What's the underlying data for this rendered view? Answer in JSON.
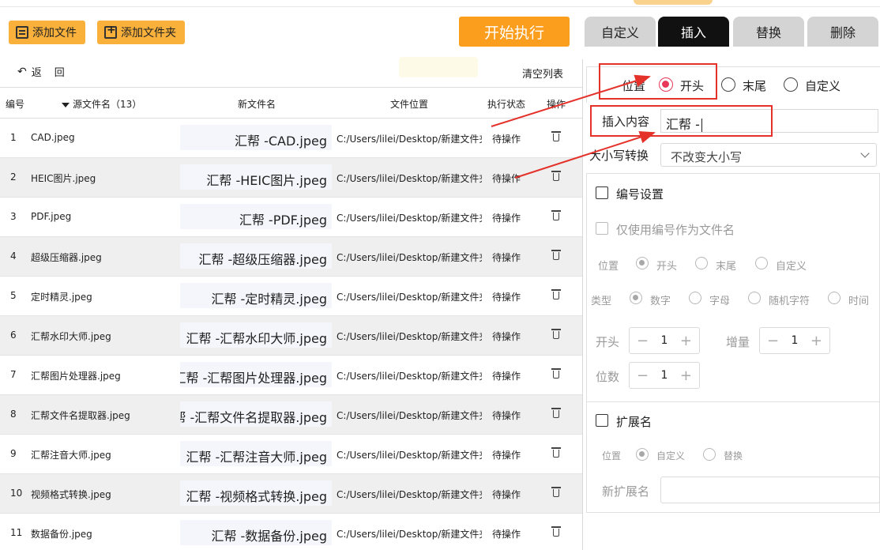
{
  "toolbar": {
    "add_file": "添加文件",
    "add_folder": "添加文件夹",
    "start": "开始执行",
    "tabs": [
      "自定义",
      "插入",
      "替换",
      "删除"
    ],
    "active_tab": "插入"
  },
  "list": {
    "back": "返",
    "back2": "回",
    "clear": "清空列表",
    "headers": {
      "num": "编号",
      "src": "源文件名（13）",
      "new": "新文件名",
      "pos": "文件位置",
      "status": "执行状态",
      "op": "操作"
    },
    "rows": [
      {
        "num": "1",
        "src": "CAD.jpeg",
        "new": "汇帮 -CAD.jpeg",
        "pos": "C:/Users/lilei/Desktop/新建文件夹",
        "status": "待操作"
      },
      {
        "num": "2",
        "src": "HEIC图片.jpeg",
        "new": "汇帮 -HEIC图片.jpeg",
        "pos": "C:/Users/lilei/Desktop/新建文件夹",
        "status": "待操作"
      },
      {
        "num": "3",
        "src": "PDF.jpeg",
        "new": "汇帮 -PDF.jpeg",
        "pos": "C:/Users/lilei/Desktop/新建文件夹",
        "status": "待操作"
      },
      {
        "num": "4",
        "src": "超级压缩器.jpeg",
        "new": "汇帮 -超级压缩器.jpeg",
        "pos": "C:/Users/lilei/Desktop/新建文件夹",
        "status": "待操作"
      },
      {
        "num": "5",
        "src": "定时精灵.jpeg",
        "new": "汇帮 -定时精灵.jpeg",
        "pos": "C:/Users/lilei/Desktop/新建文件夹",
        "status": "待操作"
      },
      {
        "num": "6",
        "src": "汇帮水印大师.jpeg",
        "new": "汇帮 -汇帮水印大师.jpeg",
        "pos": "C:/Users/lilei/Desktop/新建文件夹",
        "status": "待操作"
      },
      {
        "num": "7",
        "src": "汇帮图片处理器.jpeg",
        "new": "汇帮 -汇帮图片处理器.jpeg",
        "pos": "C:/Users/lilei/Desktop/新建文件夹",
        "status": "待操作"
      },
      {
        "num": "8",
        "src": "汇帮文件名提取器.jpeg",
        "new": "汇帮 -汇帮文件名提取器.jpeg",
        "pos": "C:/Users/lilei/Desktop/新建文件夹",
        "status": "待操作"
      },
      {
        "num": "9",
        "src": "汇帮注音大师.jpeg",
        "new": "汇帮 -汇帮注音大师.jpeg",
        "pos": "C:/Users/lilei/Desktop/新建文件夹",
        "status": "待操作"
      },
      {
        "num": "10",
        "src": "视频格式转换.jpeg",
        "new": "汇帮 -视频格式转换.jpeg",
        "pos": "C:/Users/lilei/Desktop/新建文件夹",
        "status": "待操作"
      },
      {
        "num": "11",
        "src": "数据备份.jpeg",
        "new": "汇帮 -数据备份.jpeg",
        "pos": "C:/Users/lilei/Desktop/新建文件夹",
        "status": "待操作"
      }
    ]
  },
  "panel": {
    "position_label": "位置",
    "position_options": [
      "开头",
      "末尾",
      "自定义"
    ],
    "position_selected": "开头",
    "insert_label": "插入内容",
    "insert_value": "汇帮 -",
    "case_label": "大小写转换",
    "case_value": "不改变大小写",
    "numbering": {
      "title": "编号设置",
      "only_number": "仅使用编号作为文件名",
      "position_label": "位置",
      "position_options": [
        "开头",
        "末尾",
        "自定义"
      ],
      "type_label": "类型",
      "type_options": [
        "数字",
        "字母",
        "随机字符",
        "时间"
      ],
      "start_label": "开头",
      "start_value": "1",
      "step_label": "增量",
      "step_value": "1",
      "digits_label": "位数",
      "digits_value": "1",
      "minus": "−",
      "plus": "+"
    },
    "extension": {
      "title": "扩展名",
      "position_label": "位置",
      "options": [
        "自定义",
        "替换"
      ],
      "new_ext_label": "新扩展名"
    }
  },
  "colors": {
    "orange_button": "#f9b13c",
    "start_button": "#fb9d1d",
    "active_tab": "#111111",
    "radio_active": "#e8385a",
    "annotation_red": "#e4322b"
  }
}
